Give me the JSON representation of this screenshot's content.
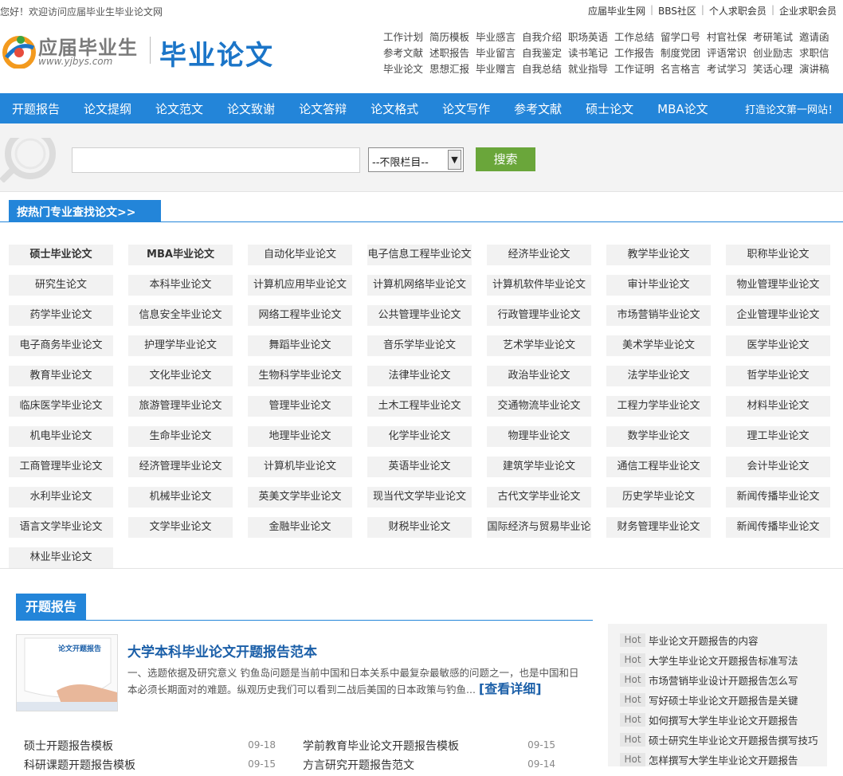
{
  "topbar": {
    "welcome": "您好！欢迎访问应届毕业生毕业论文网",
    "links": [
      "应届毕业生网",
      "BBS社区",
      "个人求职会员",
      "企业求职会员"
    ]
  },
  "logo": {
    "brand": "应届毕业生",
    "site": "www.yjbys.com",
    "title": "毕业论文"
  },
  "quick_links": [
    [
      "工作计划",
      "简历模板",
      "毕业感言",
      "自我介绍",
      "职场英语",
      "工作总结",
      "留学口号",
      "村官社保",
      "考研笔试",
      "邀请函"
    ],
    [
      "参考文献",
      "述职报告",
      "毕业留言",
      "自我鉴定",
      "读书笔记",
      "工作报告",
      "制度党团",
      "评语常识",
      "创业励志",
      "求职信"
    ],
    [
      "毕业论文",
      "思想汇报",
      "毕业赠言",
      "自我总结",
      "就业指导",
      "工作证明",
      "名言格言",
      "考试学习",
      "笑话心理",
      "演讲稿"
    ]
  ],
  "nav": {
    "items": [
      "开题报告",
      "论文提纲",
      "论文范文",
      "论文致谢",
      "论文答辩",
      "论文格式",
      "论文写作",
      "参考文献",
      "硕士论文",
      "MBA论文"
    ],
    "slogan": "打造论文第一网站！"
  },
  "search": {
    "placeholder": "",
    "select_value": "--不限栏目--",
    "button": "搜索"
  },
  "majors": {
    "heading": "按热门专业查找论文>>",
    "items": [
      "硕士毕业论文",
      "MBA毕业论文",
      "自动化毕业论文",
      "电子信息工程毕业论文",
      "经济毕业论文",
      "教学毕业论文",
      "职称毕业论文",
      "研究生论文",
      "本科毕业论文",
      "计算机应用毕业论文",
      "计算机网络毕业论文",
      "计算机软件毕业论文",
      "审计毕业论文",
      "物业管理毕业论文",
      "药学毕业论文",
      "信息安全毕业论文",
      "网络工程毕业论文",
      "公共管理毕业论文",
      "行政管理毕业论文",
      "市场营销毕业论文",
      "企业管理毕业论文",
      "电子商务毕业论文",
      "护理学毕业论文",
      "舞蹈毕业论文",
      "音乐学毕业论文",
      "艺术学毕业论文",
      "美术学毕业论文",
      "医学毕业论文",
      "教育毕业论文",
      "文化毕业论文",
      "生物科学毕业论文",
      "法律毕业论文",
      "政治毕业论文",
      "法学毕业论文",
      "哲学毕业论文",
      "临床医学毕业论文",
      "旅游管理毕业论文",
      "管理毕业论文",
      "土木工程毕业论文",
      "交通物流毕业论文",
      "工程力学毕业论文",
      "材料毕业论文",
      "机电毕业论文",
      "生命毕业论文",
      "地理毕业论文",
      "化学毕业论文",
      "物理毕业论文",
      "数学毕业论文",
      "理工毕业论文",
      "工商管理毕业论文",
      "经济管理毕业论文",
      "计算机毕业论文",
      "英语毕业论文",
      "建筑学毕业论文",
      "通信工程毕业论文",
      "会计毕业论文",
      "水利毕业论文",
      "机械毕业论文",
      "英美文学毕业论文",
      "现当代文学毕业论文",
      "古代文学毕业论文",
      "历史学毕业论文",
      "新闻传播毕业论文",
      "语言文学毕业论文",
      "文学毕业论文",
      "金融毕业论文",
      "财税毕业论文",
      "国际经济与贸易毕业论",
      "财务管理毕业论文",
      "新闻传播毕业论文",
      "林业毕业论文"
    ]
  },
  "report": {
    "tab": "开题报告",
    "thumb_caption": "论文开题报告",
    "feature_title": "大学本科毕业论文开题报告范本",
    "feature_summary": "一、选题依据及研究意义 钓鱼岛问题是当前中国和日本关系中最复杂最敏感的问题之一，也是中国和日本必须长期面对的难题。纵观历史我们可以看到二战后美国的日本政策与钓鱼...",
    "more": "[查看详细]",
    "left_list": [
      {
        "title": "硕士开题报告模板",
        "date": "09-18"
      },
      {
        "title": "科研课题开题报告模板",
        "date": "09-15"
      }
    ],
    "right_list": [
      {
        "title": "学前教育毕业论文开题报告模板",
        "date": "09-15"
      },
      {
        "title": "方言研究开题报告范文",
        "date": "09-14"
      }
    ],
    "hot_label": "Hot",
    "hot_items": [
      "毕业论文开题报告的内容",
      "大学生毕业论文开题报告标准写法",
      "市场营销毕业设计开题报告怎么写",
      "写好硕士毕业论文开题报告是关键",
      "如何撰写大学生毕业论文开题报告",
      "硕士研究生毕业论文开题报告撰写技巧",
      "怎样撰写大学生毕业论文开题报告"
    ]
  },
  "colors": {
    "primary": "#2385d9",
    "search_button": "#6aa63a"
  }
}
